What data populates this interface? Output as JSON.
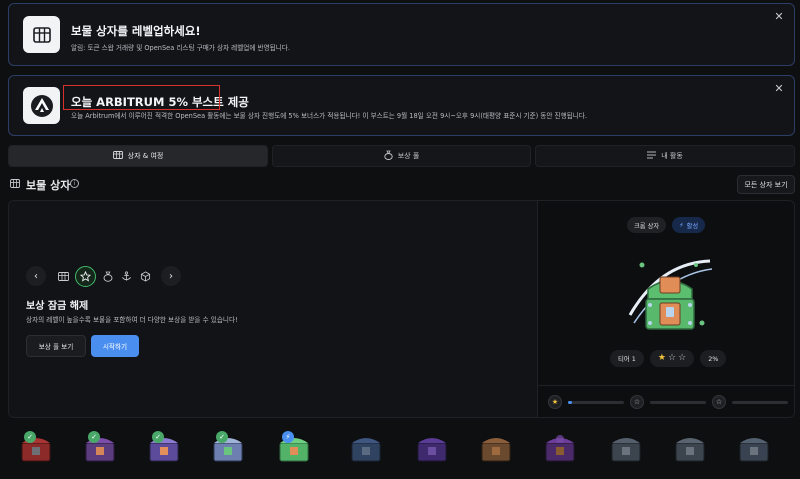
{
  "banners": [
    {
      "title": "보물 상자를 레벨업하세요!",
      "subtitle": "알림: 토큰 스왑 거래량 및 OpenSea 리스팅 구매가 상자 레벨업에 반영됩니다."
    },
    {
      "title": "오늘 ARBITRUM 5% 부스트 제공",
      "subtitle": "오늘 Arbitrum에서 이루어진 적격한 OpenSea 활동에는 보물 상자 진행도에 5% 보너스가 적용됩니다! 이 부스트는 9월 18일 오전 9시~오후 9시(태평양 표준시 기준) 동안 진행됩니다."
    }
  ],
  "tabs": [
    {
      "label": "상자 & 여정",
      "active": true
    },
    {
      "label": "보상 풀",
      "active": false
    },
    {
      "label": "내 활동",
      "active": false
    }
  ],
  "section": {
    "title": "보물 상자",
    "view_all_label": "모든 상자 보기"
  },
  "unlock": {
    "title": "보상 잠금 해제",
    "description": "상자의 레벨이 높을수록 보물을 포함하여 더 다양한 보상을 받을 수 있습니다!",
    "view_pool_label": "보상 풀 보기",
    "start_label": "시작하기"
  },
  "chest_detail": {
    "type_label": "크롬 상자",
    "status_label": "활성",
    "tier_label": "티어 1",
    "stars_filled": 1,
    "stars_total": 3,
    "percent_label": "2%",
    "progress": 0.02
  },
  "colors": {
    "accent_blue": "#4a8ff0",
    "success_green": "#49a868",
    "star_gold": "#f3c33e",
    "banner_border": "#2c3e66"
  }
}
